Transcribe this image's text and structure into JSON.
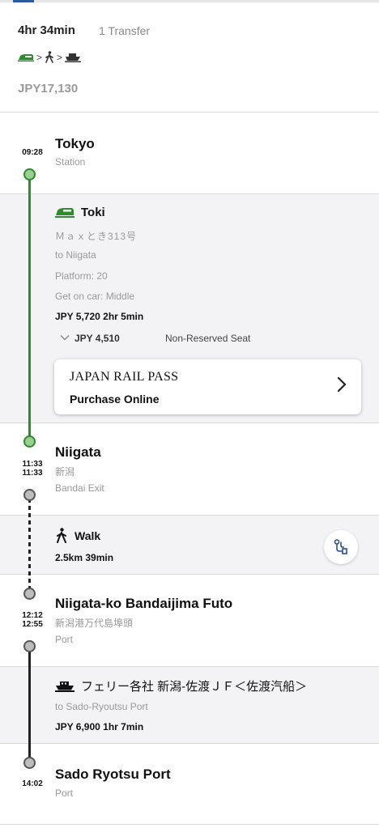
{
  "summary": {
    "duration": "4hr 34min",
    "transfers": "1 Transfer",
    "mode_sequence": [
      "train-icon",
      "walk-icon",
      "ferry-icon"
    ],
    "mode_separator": ">",
    "fare": "JPY17,130"
  },
  "stops": [
    {
      "name": "Tokyo",
      "sub": "Station",
      "arrive": "",
      "depart": "09:28"
    },
    {
      "name": "Niigata",
      "sub_jp": "新潟",
      "sub": "Bandai Exit",
      "arrive": "11:33",
      "depart": "11:33"
    },
    {
      "name": "Niigata-ko Bandaijima Futo",
      "sub_jp": "新潟港万代島埠頭",
      "sub": "Port",
      "arrive": "12:12",
      "depart": "12:55"
    },
    {
      "name": "Sado Ryotsu Port",
      "sub": "Port",
      "arrive": "14:02",
      "depart": ""
    }
  ],
  "segments": {
    "train": {
      "name": "Toki",
      "line": "Ｍａｘとき313号",
      "direction": "to Niigata",
      "platform": "Platform: 20",
      "car": "Get on car: Middle",
      "fare_time": "JPY 5,720 2hr 5min",
      "seat_price": "JPY 4,510",
      "seat_type": "Non-Reserved Seat",
      "jr_pass_title": "JAPAN RAIL PASS",
      "jr_pass_action": "Purchase Online"
    },
    "walk": {
      "label": "Walk",
      "dist_time": "2.5km 39min"
    },
    "ferry": {
      "name": "フェリー各社 新潟-佐渡ＪＦ＜佐渡汽船＞",
      "direction": "to Sado-Ryoutsu Port",
      "fare_time": "JPY 6,900 1hr 7min"
    }
  },
  "colors": {
    "train_green": "#2e8b2e",
    "route_black": "#222222",
    "muted_text": "#999999",
    "section_gray": "#f3f3f5"
  }
}
